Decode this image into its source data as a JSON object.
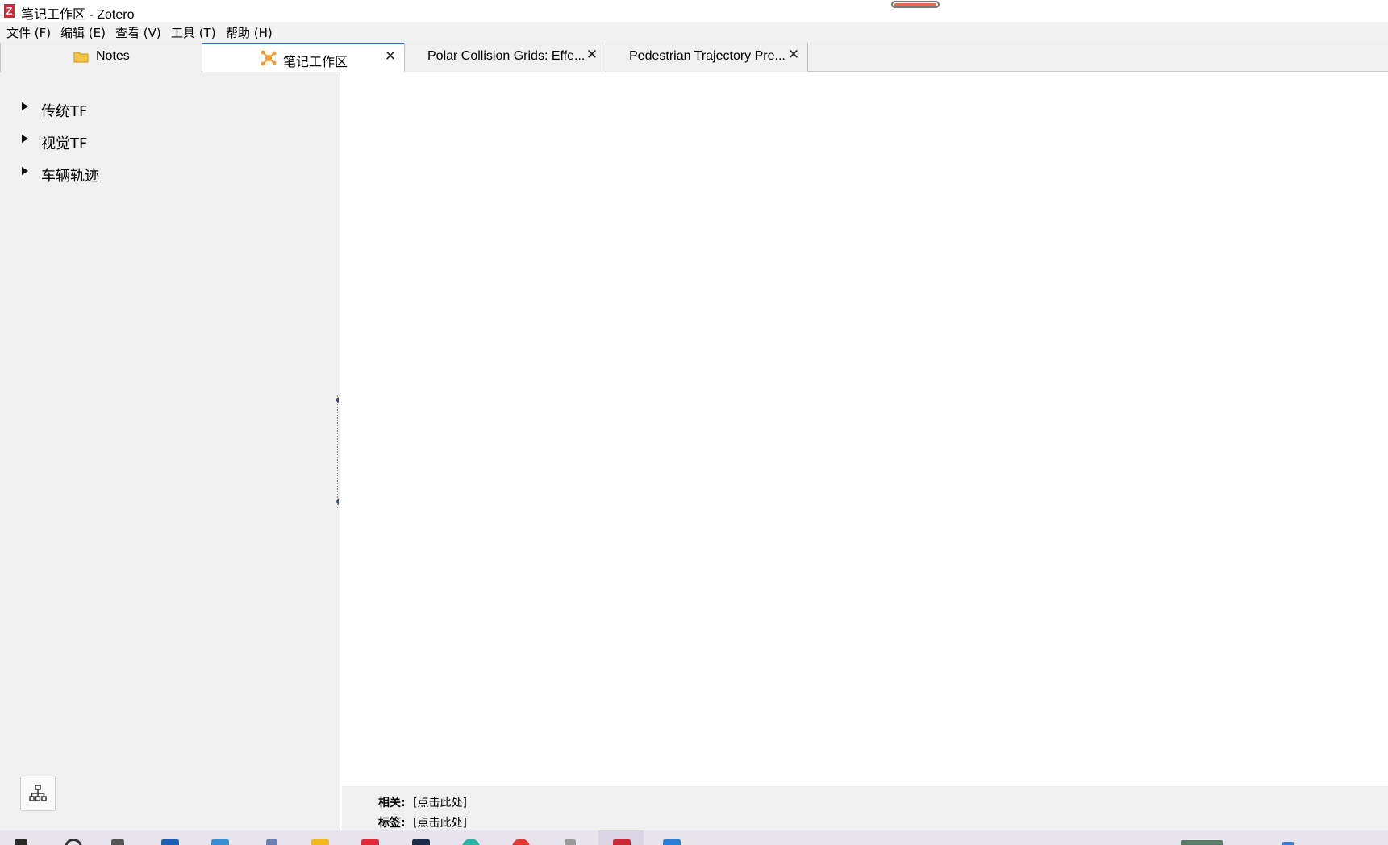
{
  "window": {
    "title": "笔记工作区 - Zotero",
    "logo_letter": "Z"
  },
  "menu": [
    {
      "label": "文件 (F)"
    },
    {
      "label": "编辑 (E)"
    },
    {
      "label": "查看 (V)"
    },
    {
      "label": "工具 (T)"
    },
    {
      "label": "帮助 (H)"
    }
  ],
  "tabs": [
    {
      "label": "Notes",
      "icon": "folder-icon",
      "selected": false
    },
    {
      "label": "笔记工作区",
      "icon": "network-icon",
      "selected": true
    },
    {
      "label": "Polar Collision Grids: Effe...",
      "selected": false
    },
    {
      "label": "Pedestrian Trajectory Pre...",
      "selected": false
    }
  ],
  "sidebar": {
    "items": [
      {
        "label": "传统TF"
      },
      {
        "label": "视觉TF"
      },
      {
        "label": "车辆轨迹"
      }
    ],
    "map_button_icon": "hierarchy-icon"
  },
  "info": {
    "related_label": "相关:",
    "related_value": "[点击此处]",
    "tags_label": "标签:",
    "tags_value": "[点击此处]"
  },
  "colors": {
    "accent": "#2f6fcc",
    "zotero_red": "#cc2936",
    "folder_yellow": "#f5c542",
    "network_orange": "#f39c2b"
  }
}
